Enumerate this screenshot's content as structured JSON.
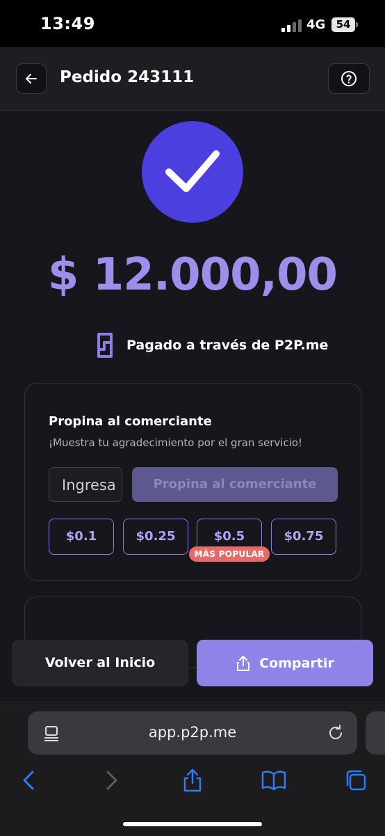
{
  "status_bar": {
    "time": "13:49",
    "network": "4G",
    "battery": "54"
  },
  "header": {
    "title": "Pedido 243111",
    "back_icon": "arrow-left-icon",
    "help_icon": "question-circle-icon"
  },
  "success": {
    "icon": "check-icon",
    "amount": "$ 12.000,00",
    "paid_via": "Pagado a través de P2P.me",
    "logo_icon": "p2p-logo-icon"
  },
  "tip_card": {
    "title": "Propina al comerciante",
    "subtitle": "¡Muestra tu agradecimiento por el gran servicio!",
    "input_placeholder": "Ingresa",
    "submit_label": "Propina al comerciante",
    "options": [
      "$0.1",
      "$0.25",
      "$0.5",
      "$0.75"
    ],
    "popular_badge": "MÁS POPULAR",
    "popular_option": "$0.5"
  },
  "actions": {
    "home_label": "Volver al Inicio",
    "share_label": "Compartir",
    "share_icon": "share-icon"
  },
  "browser": {
    "url": "app.p2p.me",
    "reader_icon": "reader-icon",
    "reload_icon": "reload-icon",
    "toolbar_icons": [
      "back-icon",
      "forward-icon",
      "share-icon",
      "bookmarks-icon",
      "tabs-icon"
    ]
  },
  "colors": {
    "accent": "#8e83e6",
    "check_circle": "#4b3fe0",
    "amount": "#9b8fe9",
    "badge": "#e66a6a",
    "ios_blue": "#2f7cf6"
  }
}
